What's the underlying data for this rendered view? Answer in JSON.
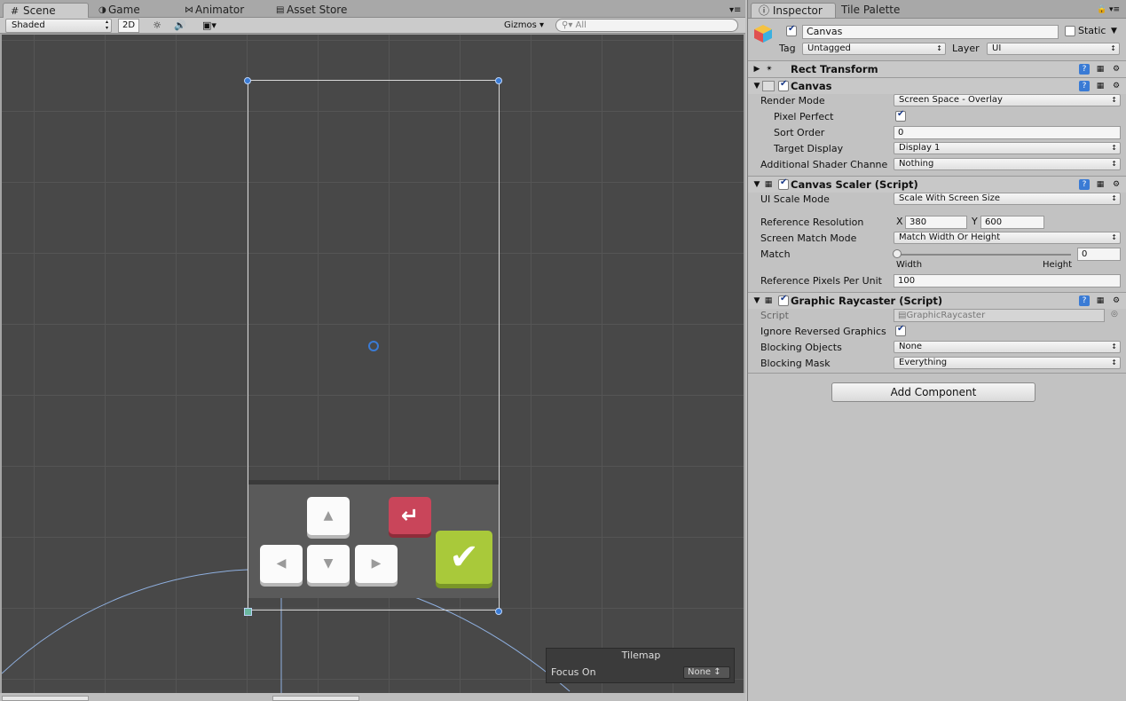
{
  "scene_tabs": [
    {
      "label": "Scene"
    },
    {
      "label": "Game"
    },
    {
      "label": "Animator"
    },
    {
      "label": "Asset Store"
    }
  ],
  "scene_toolbar": {
    "shading": "Shaded",
    "mode_2d": "2D",
    "gizmos": "Gizmos",
    "search_placeholder": "All"
  },
  "tilemap_overlay": {
    "title": "Tilemap",
    "focus_label": "Focus On",
    "focus_value": "None"
  },
  "inspector_tabs": [
    {
      "label": "Inspector"
    },
    {
      "label": "Tile Palette"
    }
  ],
  "object": {
    "name": "Canvas",
    "static_label": "Static",
    "tag_label": "Tag",
    "tag_value": "Untagged",
    "layer_label": "Layer",
    "layer_value": "UI"
  },
  "rect_transform": {
    "title": "Rect Transform"
  },
  "canvas": {
    "title": "Canvas",
    "render_mode_label": "Render Mode",
    "render_mode": "Screen Space - Overlay",
    "pixel_perfect_label": "Pixel Perfect",
    "sort_order_label": "Sort Order",
    "sort_order": "0",
    "target_display_label": "Target Display",
    "target_display": "Display 1",
    "shader_label": "Additional Shader Channe",
    "shader_value": "Nothing"
  },
  "canvas_scaler": {
    "title": "Canvas Scaler (Script)",
    "scale_mode_label": "UI Scale Mode",
    "scale_mode": "Scale With Screen Size",
    "ref_res_label": "Reference Resolution",
    "x_label": "X",
    "x_value": "380",
    "y_label": "Y",
    "y_value": "600",
    "match_mode_label": "Screen Match Mode",
    "match_mode": "Match Width Or Height",
    "match_label": "Match",
    "match_value": "0",
    "width_label": "Width",
    "height_label": "Height",
    "ppu_label": "Reference Pixels Per Unit",
    "ppu_value": "100"
  },
  "raycaster": {
    "title": "Graphic Raycaster (Script)",
    "script_label": "Script",
    "script_value": "GraphicRaycaster",
    "ignore_label": "Ignore Reversed Graphics",
    "blocking_objects_label": "Blocking Objects",
    "blocking_objects": "None",
    "blocking_mask_label": "Blocking Mask",
    "blocking_mask": "Everything"
  },
  "add_component": "Add Component",
  "colors": {
    "viewport": "#484848",
    "handle": "#3a7bd5",
    "confirm": "#a9c93a",
    "back": "#c9455a"
  }
}
